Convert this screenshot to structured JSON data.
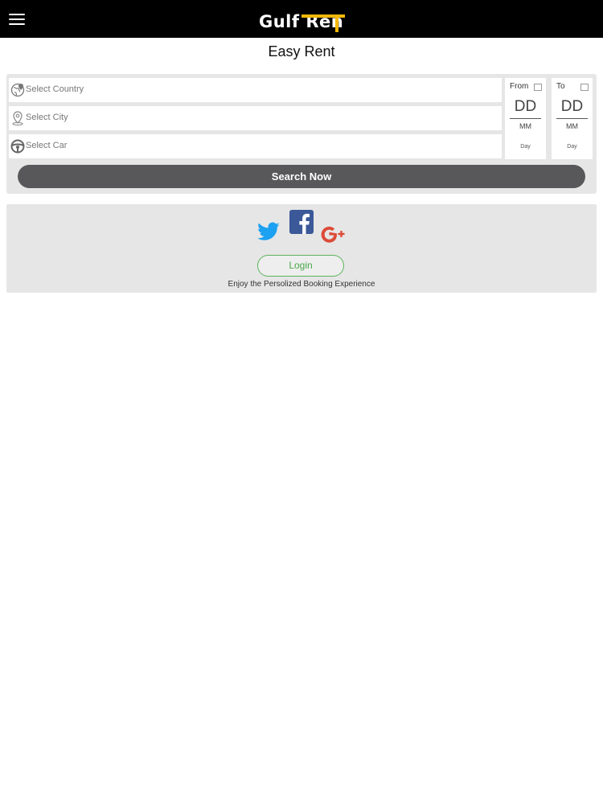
{
  "header": {
    "brand_part1": "Gulf ",
    "brand_part2": "Ren",
    "brand_part3": "T",
    "accent_color": "#f2b807",
    "menu_icon": "hamburger-menu-icon"
  },
  "page": {
    "title": "Easy Rent"
  },
  "search": {
    "country_placeholder": "Select Country",
    "city_placeholder": "Select City",
    "car_placeholder": "Select Car",
    "from": {
      "label": "From",
      "day_value": "DD",
      "month_value": "MM",
      "weekday_value": "Day"
    },
    "to": {
      "label": "To",
      "day_value": "DD",
      "month_value": "MM",
      "weekday_value": "Day"
    },
    "button_label": "Search Now"
  },
  "social": {
    "icons": [
      "twitter-icon",
      "facebook-icon",
      "google-plus-icon"
    ],
    "login_label": "Login",
    "tagline": "Enjoy the Persolized Booking Experience"
  }
}
